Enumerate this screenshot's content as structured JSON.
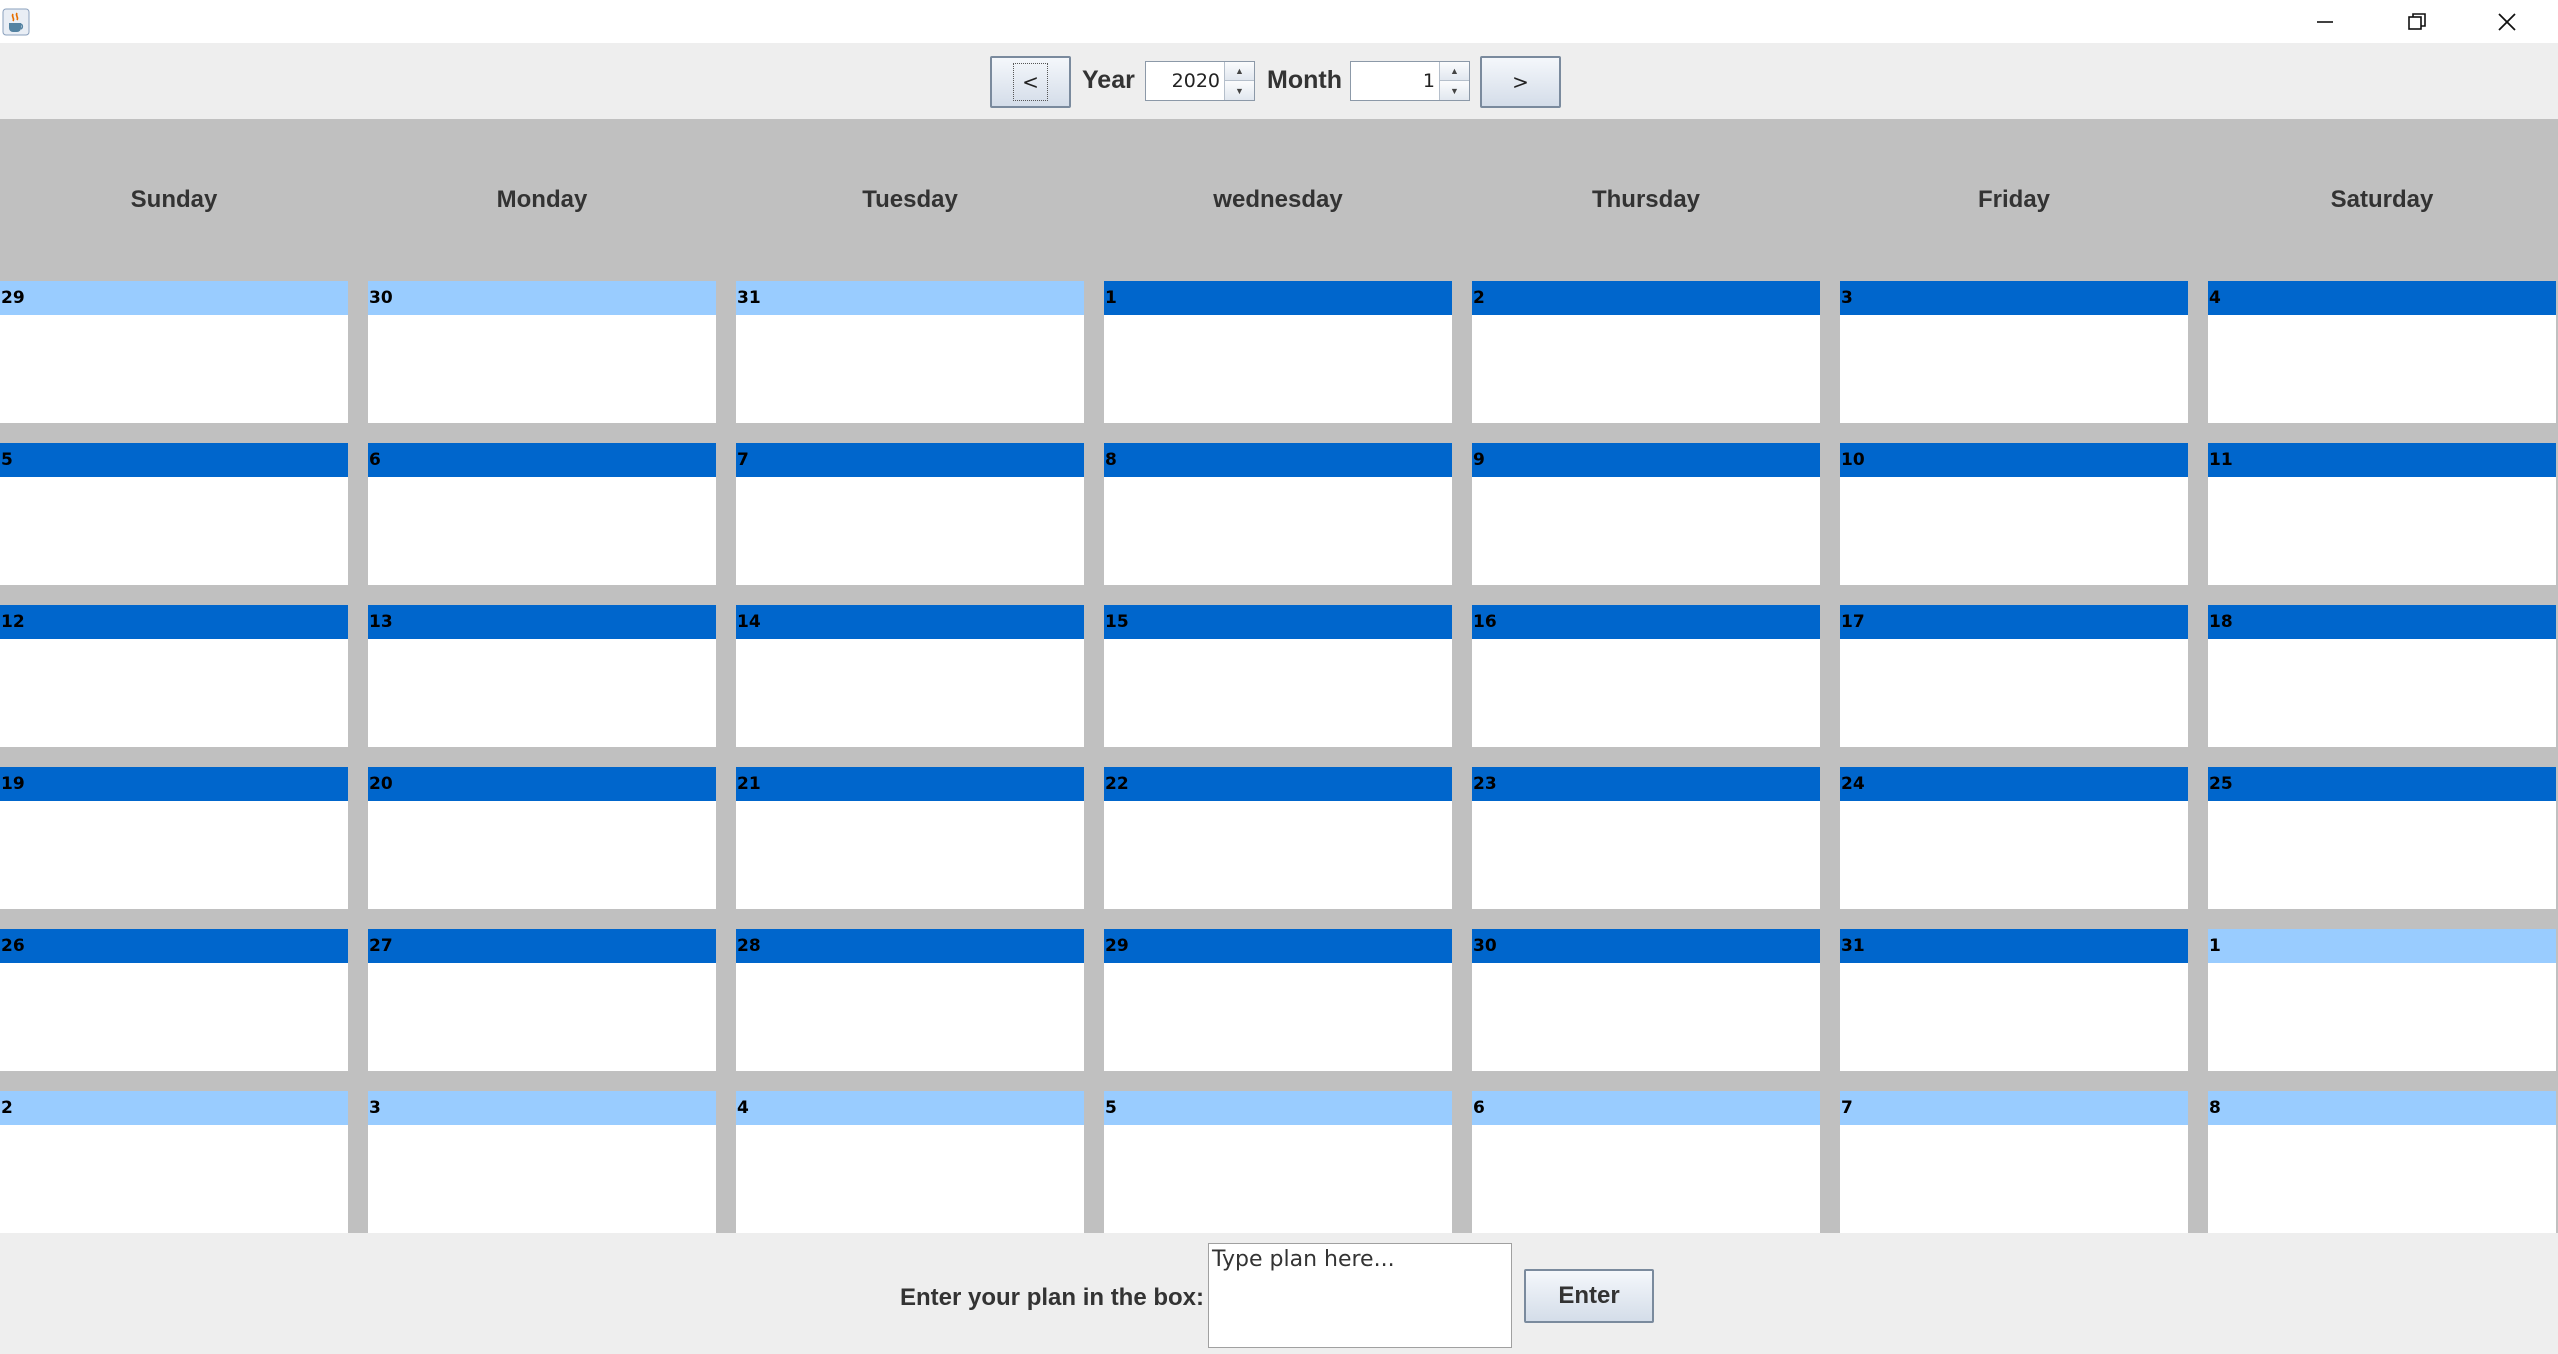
{
  "window": {
    "icon": "java-cup-icon",
    "controls": [
      "minimize-icon",
      "restore-icon",
      "close-icon"
    ]
  },
  "toolbar": {
    "prev_label": "<",
    "next_label": ">",
    "year_label": "Year",
    "year_value": "2020",
    "month_label": "Month",
    "month_value": "1"
  },
  "calendar": {
    "weekdays": [
      "Sunday",
      "Monday",
      "Tuesday",
      "wednesday",
      "Thursday",
      "Friday",
      "Saturday"
    ],
    "weeks": [
      [
        "29",
        "30",
        "31",
        "1",
        "2",
        "3",
        "4"
      ],
      [
        "5",
        "6",
        "7",
        "8",
        "9",
        "10",
        "11"
      ],
      [
        "12",
        "13",
        "14",
        "15",
        "16",
        "17",
        "18"
      ],
      [
        "19",
        "20",
        "21",
        "22",
        "23",
        "24",
        "25"
      ],
      [
        "26",
        "27",
        "28",
        "29",
        "30",
        "31",
        "1"
      ],
      [
        "2",
        "3",
        "4",
        "5",
        "6",
        "7",
        "8"
      ]
    ],
    "current_month_color": "#0066cc",
    "other_month_color": "#99ccff",
    "other_month_cells": [
      [
        0,
        0
      ],
      [
        0,
        1
      ],
      [
        0,
        2
      ],
      [
        4,
        6
      ],
      [
        5,
        0
      ],
      [
        5,
        1
      ],
      [
        5,
        2
      ],
      [
        5,
        3
      ],
      [
        5,
        4
      ],
      [
        5,
        5
      ],
      [
        5,
        6
      ]
    ]
  },
  "footer": {
    "plan_label": "Enter your plan in the box:",
    "plan_placeholder": "Type plan here...",
    "enter_label": "Enter"
  }
}
